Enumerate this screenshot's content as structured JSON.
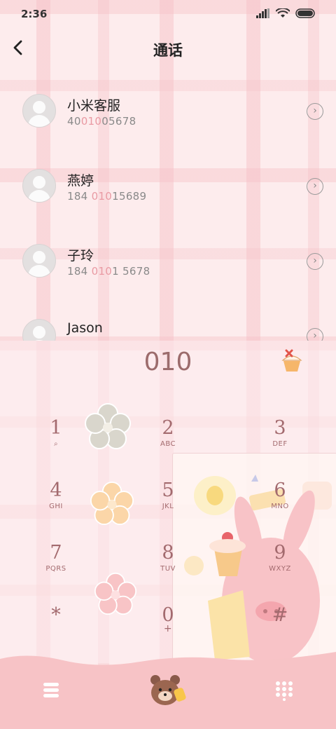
{
  "status": {
    "time": "2:36"
  },
  "header": {
    "title": "通话",
    "back_icon": "chevron-left-icon"
  },
  "contacts": [
    {
      "name": "小米客服",
      "num_pre": "40",
      "num_hl": "010",
      "num_post": "05678"
    },
    {
      "name": "燕婷",
      "num_pre": "184 ",
      "num_hl": "010",
      "num_post": "15689"
    },
    {
      "name": "子玲",
      "num_pre": "184 ",
      "num_hl": "010",
      "num_post": "1 5678"
    },
    {
      "name": "Jason",
      "num_pre": "",
      "num_hl": "",
      "num_post": ""
    }
  ],
  "dialpad": {
    "input": "010",
    "keys": [
      {
        "digit": "1",
        "letters": ""
      },
      {
        "digit": "2",
        "letters": "ABC"
      },
      {
        "digit": "3",
        "letters": "DEF"
      },
      {
        "digit": "4",
        "letters": "GHI"
      },
      {
        "digit": "5",
        "letters": "JKL"
      },
      {
        "digit": "6",
        "letters": "MNO"
      },
      {
        "digit": "7",
        "letters": "PQRS"
      },
      {
        "digit": "8",
        "letters": "TUV"
      },
      {
        "digit": "9",
        "letters": "WXYZ"
      },
      {
        "digit": "*",
        "letters": ""
      },
      {
        "digit": "0",
        "letters": "+"
      },
      {
        "digit": "#",
        "letters": ""
      }
    ]
  },
  "colors": {
    "accent": "#e99aa3",
    "key_text": "#a36a6e",
    "bottom_bar": "#f7c3c6"
  }
}
